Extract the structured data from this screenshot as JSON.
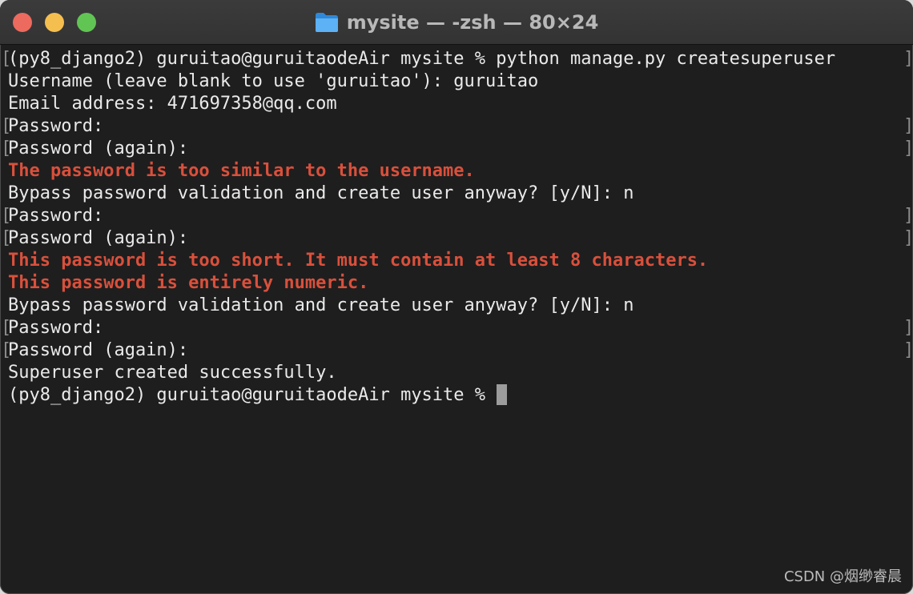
{
  "window": {
    "title": "mysite — -zsh — 80×24",
    "folder_icon": "folder-icon",
    "traffic_lights": {
      "close_color": "#ed6a5e",
      "minimize_color": "#f5bf4f",
      "zoom_color": "#61c554"
    }
  },
  "terminal": {
    "error_color": "#d9503c",
    "lines": [
      {
        "text": "(py8_django2) guruitao@guruitaodeAir mysite % python manage.py createsuperuser",
        "type": "normal",
        "markers": true
      },
      {
        "text": "Username (leave blank to use 'guruitao'): guruitao",
        "type": "normal",
        "markers": false
      },
      {
        "text": "Email address: 471697358@qq.com",
        "type": "normal",
        "markers": false
      },
      {
        "text": "Password:",
        "type": "normal",
        "markers": true
      },
      {
        "text": "Password (again):",
        "type": "normal",
        "markers": true
      },
      {
        "text": "The password is too similar to the username.",
        "type": "error",
        "markers": false
      },
      {
        "text": "Bypass password validation and create user anyway? [y/N]: n",
        "type": "normal",
        "markers": false
      },
      {
        "text": "Password:",
        "type": "normal",
        "markers": true
      },
      {
        "text": "Password (again):",
        "type": "normal",
        "markers": true
      },
      {
        "text": "This password is too short. It must contain at least 8 characters.",
        "type": "error",
        "markers": false
      },
      {
        "text": "This password is entirely numeric.",
        "type": "error",
        "markers": false
      },
      {
        "text": "Bypass password validation and create user anyway? [y/N]: n",
        "type": "normal",
        "markers": false
      },
      {
        "text": "Password:",
        "type": "normal",
        "markers": true
      },
      {
        "text": "Password (again):",
        "type": "normal",
        "markers": true
      },
      {
        "text": "Superuser created successfully.",
        "type": "normal",
        "markers": false
      },
      {
        "text": "(py8_django2) guruitao@guruitaodeAir mysite % ",
        "type": "prompt",
        "markers": false
      }
    ]
  },
  "watermark": "CSDN @烟缈睿晨"
}
